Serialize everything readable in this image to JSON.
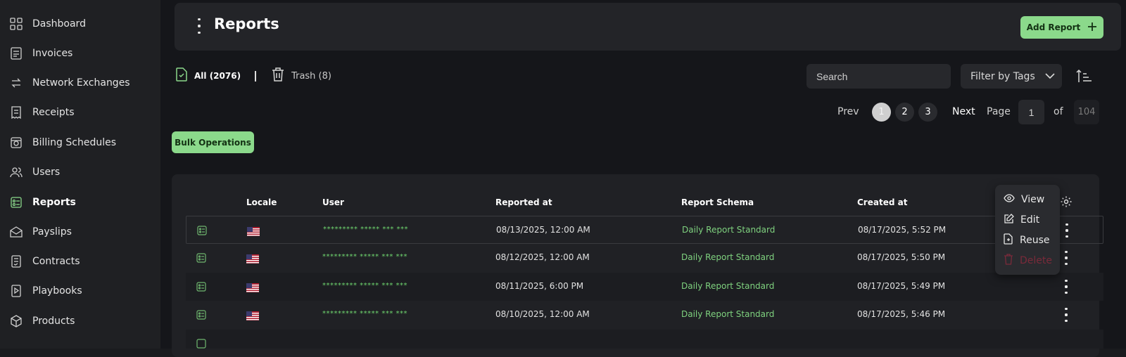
{
  "sidebar": {
    "items": [
      {
        "label": "Dashboard",
        "icon": "dashboard-icon"
      },
      {
        "label": "Invoices",
        "icon": "invoice-icon"
      },
      {
        "label": "Network Exchanges",
        "icon": "exchange-icon"
      },
      {
        "label": "Receipts",
        "icon": "receipt-icon"
      },
      {
        "label": "Billing Schedules",
        "icon": "billing-icon"
      },
      {
        "label": "Users",
        "icon": "users-icon"
      },
      {
        "label": "Reports",
        "icon": "reports-icon",
        "active": true
      },
      {
        "label": "Payslips",
        "icon": "payslip-icon"
      },
      {
        "label": "Contracts",
        "icon": "contract-icon"
      },
      {
        "label": "Playbooks",
        "icon": "playbook-icon"
      },
      {
        "label": "Products",
        "icon": "products-icon"
      }
    ]
  },
  "header": {
    "title": "Reports",
    "add_label": "Add Report"
  },
  "tabs": {
    "all": "All (2076)",
    "trash": "Trash (8)"
  },
  "search": {
    "placeholder": "Search"
  },
  "filter": {
    "label": "Filter by Tags"
  },
  "pagination": {
    "prev": "Prev",
    "pages": [
      "1",
      "2",
      "3"
    ],
    "current": "1",
    "next": "Next",
    "page_label": "Page",
    "page_value": "1",
    "of_label": "of",
    "total": "104"
  },
  "bulk_label": "Bulk Operations",
  "table": {
    "columns": [
      "Locale",
      "User",
      "Reported at",
      "Report Schema",
      "Created at"
    ],
    "rows": [
      {
        "user": "********* ***** *** ***",
        "reported": "08/13/2025, 12:00 AM",
        "schema": "Daily Report Standard",
        "created": "08/17/2025, 5:52 PM"
      },
      {
        "user": "********* ***** *** ***",
        "reported": "08/12/2025, 12:00 AM",
        "schema": "Daily Report Standard",
        "created": "08/17/2025, 5:50 PM"
      },
      {
        "user": "********* ***** *** ***",
        "reported": "08/11/2025, 6:00 PM",
        "schema": "Daily Report Standard",
        "created": "08/17/2025, 5:49 PM"
      },
      {
        "user": "********* ***** *** ***",
        "reported": "08/10/2025, 12:00 AM",
        "schema": "Daily Report Standard",
        "created": "08/17/2025, 5:46 PM"
      }
    ]
  },
  "context_menu": {
    "view": "View",
    "edit": "Edit",
    "reuse": "Reuse",
    "delete": "Delete"
  },
  "colors": {
    "accent": "#8bd98b",
    "danger": "#7a2a3a",
    "user_text": "#6fd76f"
  }
}
